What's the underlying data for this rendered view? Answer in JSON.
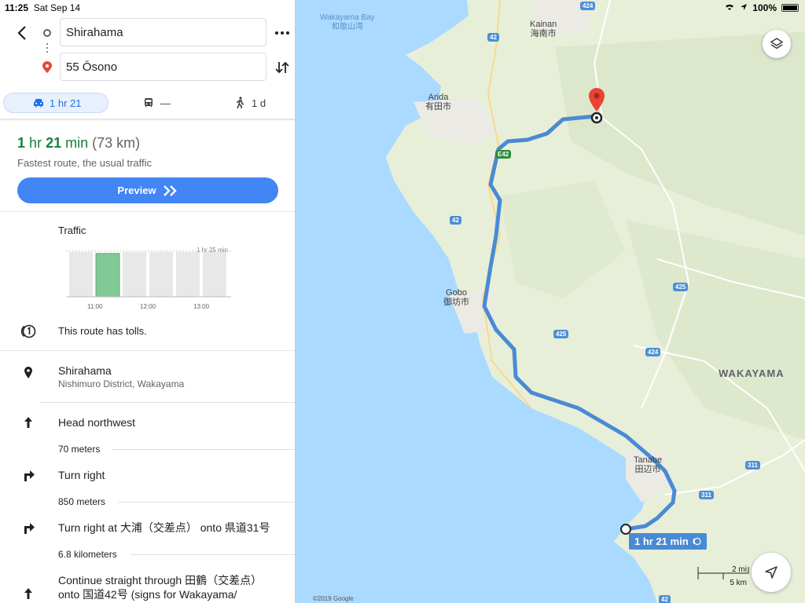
{
  "status_bar": {
    "time": "11:25",
    "date": "Sat Sep 14",
    "battery": "100%"
  },
  "search": {
    "from": "Shirahama",
    "to": "55 Ōsono"
  },
  "modes": {
    "car": "1 hr 21",
    "transit": "—",
    "walk": "1 d"
  },
  "route": {
    "duration_num1": "1",
    "duration_unit1": "hr",
    "duration_num2": "21",
    "duration_unit2": "min",
    "distance": "(73 km)",
    "description": "Fastest route, the usual traffic",
    "preview_label": "Preview"
  },
  "traffic": {
    "title": "Traffic",
    "max_label": "1 hr 25 min",
    "ticks": [
      "11:00",
      "12:00",
      "13:00"
    ],
    "bars": [
      0.95,
      0.92,
      0.95,
      0.95,
      0.95,
      0.95
    ],
    "selected_index": 1
  },
  "tolls_text": "This route has tolls.",
  "start": {
    "title": "Shirahama",
    "subtitle": "Nishimuro District, Wakayama"
  },
  "steps": [
    {
      "instruction": "Head northwest",
      "distance": "70 meters",
      "icon": "arrow-up-icon"
    },
    {
      "instruction": "Turn right",
      "distance": "850 meters",
      "icon": "turn-right-icon"
    },
    {
      "instruction": "Turn right at 大浦（交差点） onto 県道31号",
      "distance": "6.8 kilometers",
      "icon": "turn-right-icon"
    },
    {
      "instruction": "Continue straight through 田鶴（交差点） onto 国道42号 (signs for Wakayama/",
      "icon": "arrow-up-icon"
    }
  ],
  "map": {
    "labels": {
      "wakayama_bay": "Wakayama Bay",
      "wakayama_bay_jp": "和歌山湾",
      "kainan": "Kainan",
      "kainan_jp": "海南市",
      "arida": "Arida",
      "arida_jp": "有田市",
      "gobo": "Gobo",
      "gobo_jp": "御坊市",
      "tanabe": "Tanabe",
      "tanabe_jp": "田辺市",
      "wakayama": "WAKAYAMA"
    },
    "shields": {
      "r424": "424",
      "r42": "42",
      "e42": "E42",
      "r425": "425",
      "r311": "311"
    },
    "route_callout": "1 hr 21 min",
    "scale_mi": "2 mi",
    "scale_km": "5 km",
    "copyright": "©2019 Google",
    "colors": {
      "water": "#aadaff",
      "land": "#e6efd8",
      "route": "#4a8ad4",
      "pin": "#ea4335"
    }
  }
}
